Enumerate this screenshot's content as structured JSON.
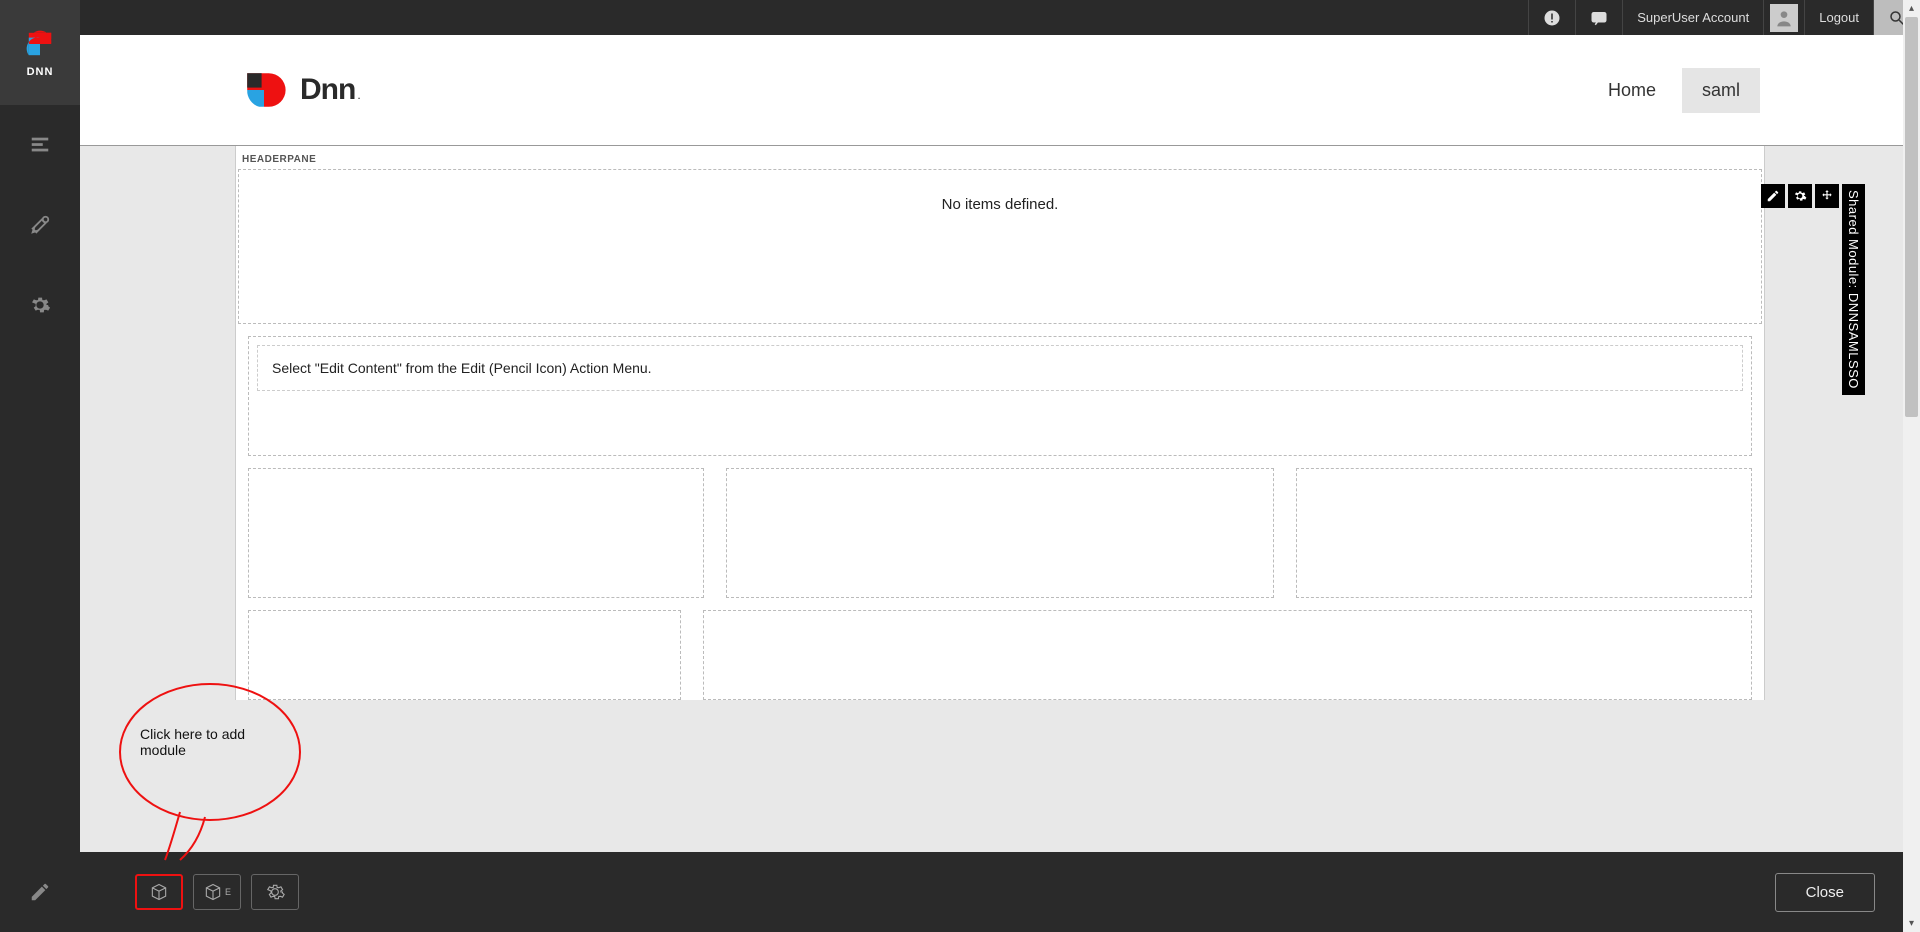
{
  "brand": {
    "name": "DNN"
  },
  "topbar": {
    "user_label": "SuperUser Account",
    "logout_label": "Logout"
  },
  "nav": {
    "items": [
      {
        "label": "Home",
        "active": false
      },
      {
        "label": "saml",
        "active": true
      }
    ]
  },
  "logo_text": "Dnn",
  "panes": {
    "header_label": "HEADERPANE",
    "no_items": "No items defined.",
    "edit_hint": "Select \"Edit Content\" from the Edit (Pencil Icon) Action Menu.",
    "shared_tag": "Shared Module: DNNSAMLSSO"
  },
  "bottom": {
    "close_label": "Close",
    "sublabel_e": "E"
  },
  "annotation": {
    "text": "Click here to add module"
  }
}
